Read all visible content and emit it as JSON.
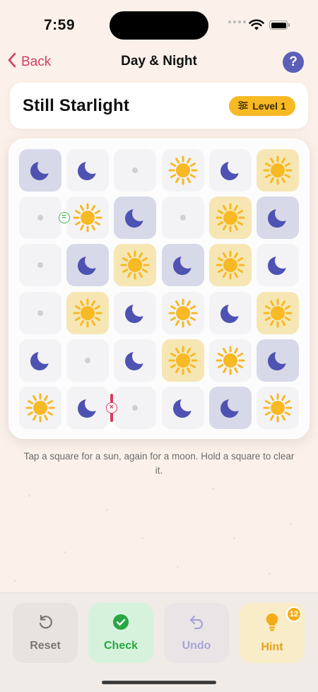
{
  "status_bar": {
    "time": "7:59"
  },
  "nav": {
    "back_label": "Back",
    "title": "Day & Night",
    "help_label": "?"
  },
  "puzzle": {
    "name": "Still Starlight",
    "level_label": "Level 1"
  },
  "grid": [
    [
      "moon-locked",
      "moon",
      "empty",
      "sun",
      "moon",
      "sun-locked"
    ],
    [
      "empty",
      "sun",
      "moon-locked",
      "empty",
      "sun-locked",
      "moon-locked"
    ],
    [
      "empty",
      "moon-locked",
      "sun-locked",
      "moon-locked",
      "sun-locked",
      "moon"
    ],
    [
      "empty",
      "sun-locked",
      "moon",
      "sun",
      "moon",
      "sun-locked"
    ],
    [
      "moon",
      "empty",
      "moon",
      "sun-locked",
      "sun",
      "moon-locked"
    ],
    [
      "sun",
      "moon",
      "empty",
      "moon",
      "moon-locked",
      "sun"
    ]
  ],
  "constraints": [
    {
      "type": "equal",
      "symbol": "=",
      "between": [
        [
          1,
          0
        ],
        [
          1,
          1
        ]
      ]
    },
    {
      "type": "opposite",
      "symbol": "×",
      "between": [
        [
          5,
          1
        ],
        [
          5,
          2
        ]
      ]
    }
  ],
  "instructions": "Tap a square for a sun, again for a moon. Hold a square to clear it.",
  "toolbar": {
    "reset_label": "Reset",
    "check_label": "Check",
    "undo_label": "Undo",
    "hint_label": "Hint",
    "hint_count": "12"
  },
  "colors": {
    "accent": "#d43d62",
    "moon": "#4e52b2",
    "sun": "#f7b924",
    "check_green": "#28a744",
    "help_bg": "#5b5fb7"
  },
  "icons": {
    "back": "chevron-left-icon",
    "help": "question-mark-icon",
    "level": "sliders-icon",
    "reset": "rotate-ccw-icon",
    "check": "check-circle-icon",
    "undo": "undo-arrow-icon",
    "hint": "lightbulb-icon"
  }
}
